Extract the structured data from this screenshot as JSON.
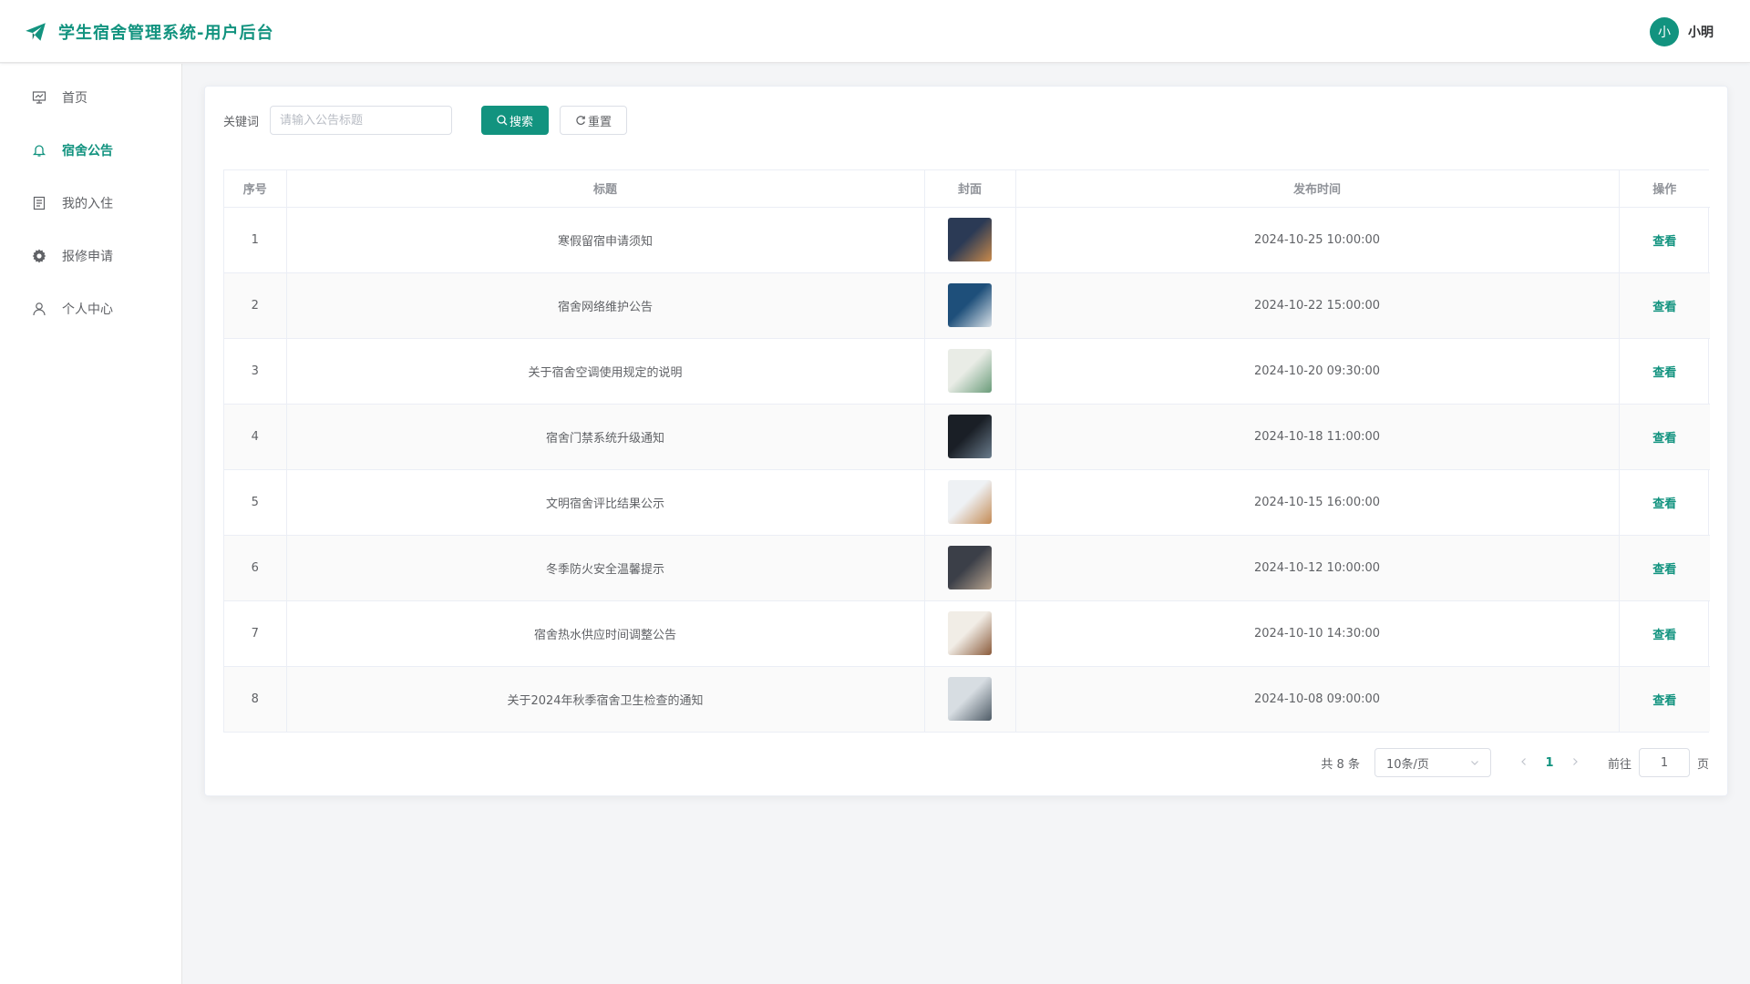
{
  "app": {
    "title": "学生宿舍管理系统-用户后台",
    "brand_color": "#12937f",
    "logo_icon": "paper-plane-icon"
  },
  "user": {
    "avatar_text": "小",
    "name": "小明"
  },
  "sidebar": {
    "items": [
      {
        "label": "首页",
        "icon": "presentation-board-icon",
        "active": false
      },
      {
        "label": "宿舍公告",
        "icon": "bell-icon",
        "active": true
      },
      {
        "label": "我的入住",
        "icon": "document-icon",
        "active": false
      },
      {
        "label": "报修申请",
        "icon": "gear-icon",
        "active": false
      },
      {
        "label": "个人中心",
        "icon": "user-icon",
        "active": false
      }
    ]
  },
  "search": {
    "label": "关键词",
    "placeholder": "请输入公告标题",
    "value": "",
    "search_button": "搜索",
    "reset_button": "重置"
  },
  "table": {
    "headers": {
      "index": "序号",
      "title": "标题",
      "cover": "封面",
      "time": "发布时间",
      "action": "操作"
    },
    "action_label": "查看",
    "rows": [
      {
        "index": "1",
        "title": "寒假留宿申请须知",
        "time": "2024-10-25 10:00:00",
        "cover_colors": [
          "#2b3a55",
          "#c98a4b"
        ]
      },
      {
        "index": "2",
        "title": "宿舍网络维护公告",
        "time": "2024-10-22 15:00:00",
        "cover_colors": [
          "#1e4f7a",
          "#d9e1e8"
        ]
      },
      {
        "index": "3",
        "title": "关于宿舍空调使用规定的说明",
        "time": "2024-10-20 09:30:00",
        "cover_colors": [
          "#e9ece6",
          "#6a9c7a"
        ]
      },
      {
        "index": "4",
        "title": "宿舍门禁系统升级通知",
        "time": "2024-10-18 11:00:00",
        "cover_colors": [
          "#1a1f26",
          "#6a7c8c"
        ]
      },
      {
        "index": "5",
        "title": "文明宿舍评比结果公示",
        "time": "2024-10-15 16:00:00",
        "cover_colors": [
          "#eef1f4",
          "#c48b55"
        ]
      },
      {
        "index": "6",
        "title": "冬季防火安全温馨提示",
        "time": "2024-10-12 10:00:00",
        "cover_colors": [
          "#3b3f48",
          "#b7a490"
        ]
      },
      {
        "index": "7",
        "title": "宿舍热水供应时间调整公告",
        "time": "2024-10-10 14:30:00",
        "cover_colors": [
          "#f1ede6",
          "#8a5a3a"
        ]
      },
      {
        "index": "8",
        "title": "关于2024年秋季宿舍卫生检查的通知",
        "time": "2024-10-08 09:00:00",
        "cover_colors": [
          "#d7dde2",
          "#4e5b66"
        ]
      }
    ]
  },
  "pagination": {
    "total_text": "共 8 条",
    "page_size": "10条/页",
    "current_page": "1",
    "goto_label": "前往",
    "goto_value": "1",
    "page_unit": "页"
  }
}
